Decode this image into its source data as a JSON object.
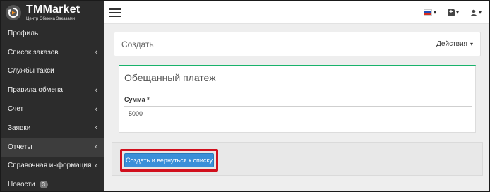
{
  "brand": {
    "title": "TMMarket",
    "subtitle": "Центр Обмена Заказами",
    "logo_icon": "refresh-logo-icon"
  },
  "sidebar": {
    "items": [
      {
        "label": "Профиль",
        "has_chevron": false
      },
      {
        "label": "Список заказов",
        "has_chevron": true
      },
      {
        "label": "Службы такси",
        "has_chevron": false
      },
      {
        "label": "Правила обмена",
        "has_chevron": true
      },
      {
        "label": "Счет",
        "has_chevron": true
      },
      {
        "label": "Заявки",
        "has_chevron": true
      },
      {
        "label": "Отчеты",
        "has_chevron": true,
        "active": true
      },
      {
        "label": "Справочная информация",
        "has_chevron": true
      },
      {
        "label": "Новости",
        "badge": "3"
      }
    ],
    "chevron": "‹"
  },
  "topbar": {
    "menu_icon": "hamburger-icon",
    "language_icon": "russian-flag-icon",
    "add_icon": "plus-square-icon",
    "user_icon": "user-icon",
    "caret": "▾"
  },
  "header_panel": {
    "title": "Создать",
    "actions_label": "Действия",
    "actions_caret": "▾"
  },
  "form": {
    "title": "Обещанный платеж",
    "amount_label": "Сумма *",
    "amount_value": "5000"
  },
  "footer": {
    "submit_label": "Создать и вернуться к списку"
  },
  "colors": {
    "sidebar_bg": "#2c2c2c",
    "accent_green": "#18b26b",
    "button_blue": "#3a8fd8",
    "highlight_red": "#d10f1c"
  }
}
